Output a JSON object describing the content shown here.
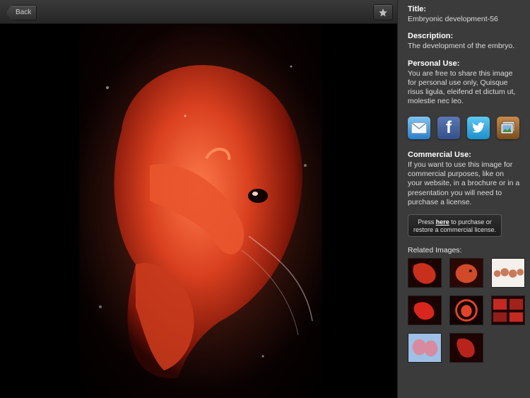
{
  "toolbar": {
    "back_label": "Back",
    "favorite_icon": "star-icon"
  },
  "details": {
    "title_heading": "Title:",
    "title_value": "Embryonic development-56",
    "description_heading": "Description:",
    "description_value": "The development of the embryo.",
    "personal_heading": "Personal Use:",
    "personal_value": "You are free to share this image for personal use only, Quisque risus ligula, eleifend et dictum ut, molestie nec leo.",
    "commercial_heading": "Commercial Use:",
    "commercial_value": "If you want to use this image for commercial purposes, like on your website, in a brochure or in a presentation you will need to purchase a license."
  },
  "share": {
    "icons": [
      "mail-icon",
      "facebook-icon",
      "twitter-icon",
      "photos-icon"
    ],
    "facebook_glyph": "f"
  },
  "purchase": {
    "prefix": "Press ",
    "link": "here",
    "suffix_line1": " to purchase or",
    "line2": "restore a commercial license."
  },
  "related": {
    "label": "Related Images:",
    "thumbnails": [
      {
        "bg": "#1a0402",
        "fg": "#c9301c"
      },
      {
        "bg": "#2a0805",
        "fg": "#d04a2a"
      },
      {
        "bg": "#f4f0ec",
        "fg": "#c97a5a"
      },
      {
        "bg": "#1a0303",
        "fg": "#d8261c"
      },
      {
        "bg": "#140202",
        "fg": "#e0442a"
      },
      {
        "bg": "#200404",
        "fg": "#c22a22"
      },
      {
        "bg": "#9fc0e6",
        "fg": "#d88aa0"
      },
      {
        "bg": "#1e0303",
        "fg": "#b8241c"
      }
    ]
  },
  "colors": {
    "panel_bg": "#3b3b3b",
    "viewer_bg": "#000000",
    "embryo": "#d9401f"
  }
}
